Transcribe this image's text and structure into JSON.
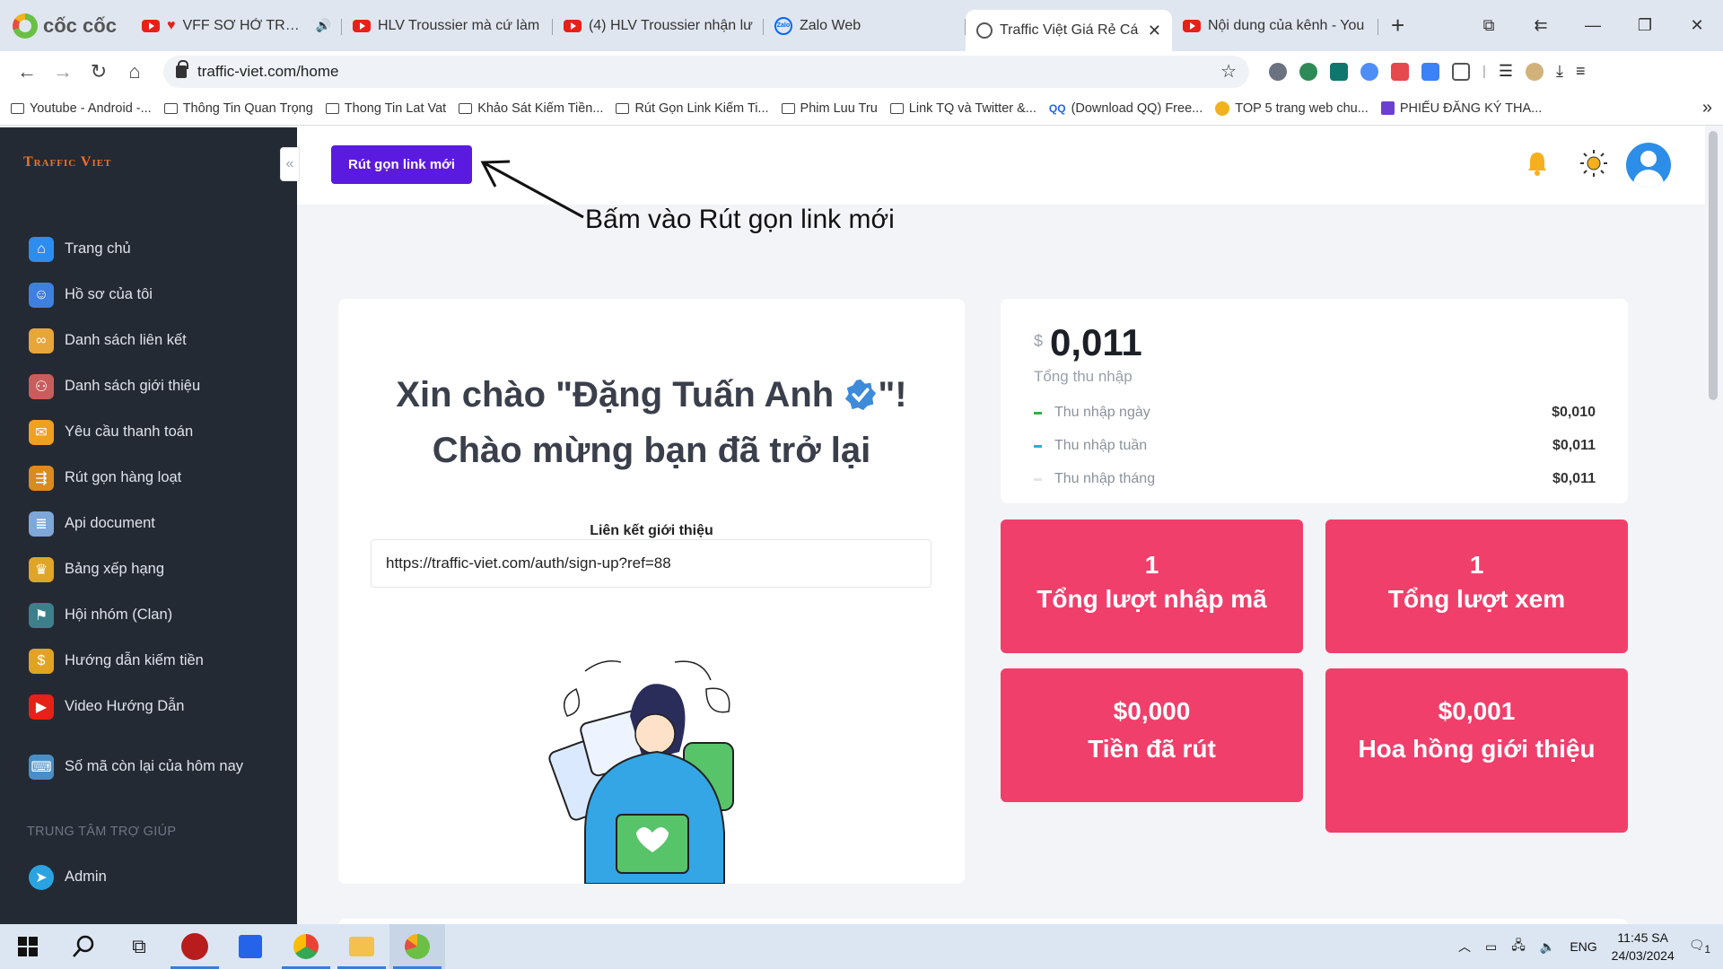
{
  "browser": {
    "name": "cốc cốc",
    "tabs": [
      {
        "label": "VFF SƠ HỞ TRONG",
        "prefix": "♥",
        "icon": "youtube-icon"
      },
      {
        "label": "HLV Troussier mà cứ làm",
        "icon": "youtube-icon"
      },
      {
        "label": "(4) HLV Troussier nhận lư",
        "icon": "youtube-icon"
      },
      {
        "label": "Zalo Web",
        "icon": "zalo-icon"
      },
      {
        "label": "Traffic Việt Giá Rẻ Cá",
        "icon": "globe-icon",
        "active": true
      },
      {
        "label": "Nội dung của kênh - You",
        "icon": "youtube-icon"
      }
    ],
    "url": "traffic-viet.com/home",
    "bookmarks": [
      "Youtube - Android -...",
      "Thông Tin Quan Trọng",
      "Thong Tin Lat Vat",
      "Khảo Sát Kiếm Tiền...",
      "Rút Gọn Link Kiếm Ti...",
      "Phim Luu Tru",
      "Link TQ và Twitter &...",
      "(Download QQ) Free...",
      "TOP 5 trang web chu...",
      "PHIẾU ĐĂNG KÝ THA..."
    ]
  },
  "app": {
    "brand": "Traffic Viet",
    "shorten_button": "Rút gọn link mới",
    "annotation": "Bấm vào Rút gọn link mới",
    "menu": [
      {
        "label": "Trang chủ",
        "icon": "home-icon",
        "color": "#2d8cf0"
      },
      {
        "label": "Hồ sơ của tôi",
        "icon": "user-profile-icon",
        "color": "#3f7fe0"
      },
      {
        "label": "Danh sách liên kết",
        "icon": "link-list-icon",
        "color": "#e8a53a"
      },
      {
        "label": "Danh sách giới thiệu",
        "icon": "referral-icon",
        "color": "#c85d5d"
      },
      {
        "label": "Yêu cầu thanh toán",
        "icon": "payment-request-icon",
        "color": "#f0a020"
      },
      {
        "label": "Rút gọn hàng loạt",
        "icon": "bulk-shorten-icon",
        "color": "#d98b1f"
      },
      {
        "label": "Api document",
        "icon": "api-document-icon",
        "color": "#7fa7d8"
      },
      {
        "label": "Bảng xếp hạng",
        "icon": "leaderboard-icon",
        "color": "#e0a526"
      },
      {
        "label": "Hội nhóm (Clan)",
        "icon": "clan-icon",
        "color": "#3e7f8c"
      },
      {
        "label": "Hướng dẫn kiếm tiền",
        "icon": "dollar-guide-icon",
        "color": "#e2a322"
      },
      {
        "label": "Video Hướng Dẫn",
        "icon": "video-guide-icon",
        "color": "#e62117"
      },
      {
        "label": "Số mã còn lại của hôm nay",
        "icon": "remaining-codes-icon",
        "color": "#4a8fc4"
      }
    ],
    "help_section": "TRUNG TÂM TRỢ GIÚP",
    "admin": {
      "label": "Admin",
      "icon": "telegram-icon",
      "color": "#2aa3e0"
    },
    "welcome": {
      "line1_prefix": "Xin chào \"Đặng Tuấn Anh",
      "line1_suffix": "\"!",
      "line2": "Chào mừng bạn đã trở lại"
    },
    "referral": {
      "label": "Liên kết giới thiệu",
      "value": "https://traffic-viet.com/auth/sign-up?ref=88"
    },
    "income": {
      "currency": "$",
      "total": "0,011",
      "label": "Tổng thu nhập",
      "rows": [
        {
          "name": "Thu nhập ngày",
          "value": "$0,010",
          "color": "#2fb344"
        },
        {
          "name": "Thu nhập tuần",
          "value": "$0,011",
          "color": "#26b0d8"
        },
        {
          "name": "Thu nhập tháng",
          "value": "$0,011",
          "color": "#e1e4e8"
        }
      ]
    },
    "stats": [
      {
        "value": "1",
        "label": "Tổng lượt nhập mã"
      },
      {
        "value": "1",
        "label": "Tổng lượt xem"
      },
      {
        "value": "$0,000",
        "label": "Tiền đã rút"
      },
      {
        "value": "$0,001",
        "label": "Hoa hồng giới thiệu"
      }
    ],
    "accent_color": "#5b1adf",
    "stat_color": "#f13f6b"
  },
  "taskbar": {
    "language": "ENG",
    "time": "11:45 SA",
    "date": "24/03/2024",
    "notification_count": "1"
  }
}
